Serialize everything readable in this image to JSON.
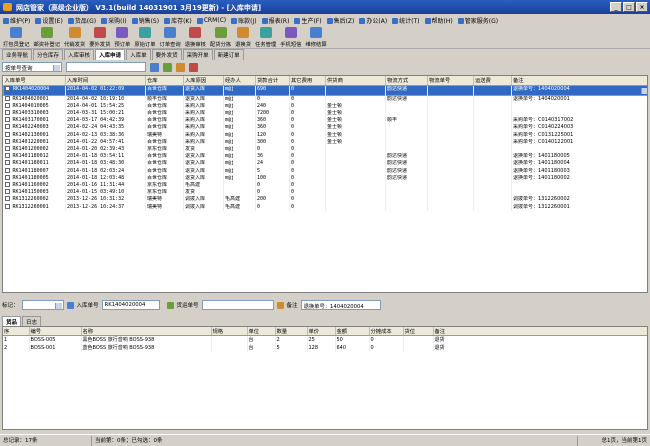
{
  "window": {
    "title": "网店管家（高级企业版） V3.1(build 14031901 3月19更新) - [入库申请]"
  },
  "menu": [
    "维护(P)",
    "设置(E)",
    "货品(G)",
    "采购(I)",
    "销售(S)",
    "库存(K)",
    "CRM(C)",
    "账款(J)",
    "报表(R)",
    "生产(F)",
    "售后(Z)",
    "办公(A)",
    "统计(T)",
    "帮助(H)",
    "管家服务(G)"
  ],
  "toolbar": [
    {
      "label": "打包员登记",
      "color": "#4a7fd0"
    },
    {
      "label": "邮资补登记",
      "color": "#6a9e3a"
    },
    {
      "label": "代销发货",
      "color": "#d08a30"
    },
    {
      "label": "要外发货",
      "color": "#c04a4a"
    },
    {
      "label": "预订单",
      "color": "#7a5ac0"
    },
    {
      "label": "原始订单",
      "color": "#3aa0a0"
    },
    {
      "label": "订单查询",
      "color": "#4a7fd0"
    },
    {
      "label": "退换审核",
      "color": "#c04a4a"
    },
    {
      "label": "配货分拣",
      "color": "#6a9e3a"
    },
    {
      "label": "退换货",
      "color": "#d08a30"
    },
    {
      "label": "任务管理",
      "color": "#3aa0a0"
    },
    {
      "label": "手机短信",
      "color": "#7a5ac0"
    },
    {
      "label": "维修结算",
      "color": "#4a7fd0"
    }
  ],
  "tabs": [
    "业务导航",
    "分仓库存",
    "入库审核",
    "入库申请",
    "入库单",
    "要外发货",
    "采购开单",
    "新建订单"
  ],
  "filter": {
    "select": "按单号查询"
  },
  "grid": {
    "columns": [
      "入库单号",
      "入库时间",
      "仓库",
      "入库原因",
      "经办人",
      "货款合计",
      "其它费用",
      "供货商",
      "物流方式",
      "物流单号",
      "运送费",
      "备注"
    ],
    "rows": [
      [
        "RK1404020004",
        "2014-04-02  01:22:09",
        "百世仓库",
        "退货入库",
        "m@j",
        "690",
        "0",
        "",
        "韵达快递",
        "",
        "",
        "退换单号：1404020004"
      ],
      [
        "RK1404020001",
        "2014-04-02  10:19:10",
        "顺丰仓库",
        "退货入库",
        "m@j",
        "0",
        "0",
        "",
        "韵达快递",
        "",
        "",
        "退换单号：1404020001"
      ],
      [
        "RK1404010005",
        "2014-04-01  15:54:25",
        "百世仓库",
        "采购入库",
        "m@j",
        "240",
        "0",
        "金士顿",
        "",
        "",
        "",
        ""
      ],
      [
        "RK1403310003",
        "2014-03-31  15:00:21",
        "百世仓库",
        "采购入库",
        "m@j",
        "7200",
        "0",
        "金士顿",
        "",
        "",
        "",
        ""
      ],
      [
        "RK1403170001",
        "2014-03-17  04:42:39",
        "百世仓库",
        "采购入库",
        "m@j",
        "360",
        "0",
        "金士顿",
        "顺丰",
        "",
        "",
        "采购单号：C0140317002"
      ],
      [
        "RK1402240003",
        "2014-02-24  04:43:35",
        "百世仓库",
        "采购入库",
        "m@j",
        "360",
        "0",
        "金士顿",
        "",
        "",
        "",
        "采购单号：C0140224003"
      ],
      [
        "RK1402130001",
        "2014-02-13  03:38:36",
        "瑞美特",
        "采购入库",
        "m@j",
        "120",
        "0",
        "金士顿",
        "",
        "",
        "",
        "采购单号：C0131225001"
      ],
      [
        "RK1401220001",
        "2014-01-22  04:57:41",
        "百世仓库",
        "采购入库",
        "m@j",
        "300",
        "0",
        "金士顿",
        "",
        "",
        "",
        "采购单号：C0140122001"
      ],
      [
        "RK1401200002",
        "2014-01-20  02:39:43",
        "京东仓库",
        "发货",
        "m@j",
        "0",
        "0",
        "",
        "",
        "",
        "",
        ""
      ],
      [
        "RK1401180012",
        "2014-01-18  03:54:11",
        "百世仓库",
        "退货入库",
        "m@j",
        "36",
        "0",
        "",
        "韵达快递",
        "",
        "",
        "退换单号：1401180005"
      ],
      [
        "RK1401180011",
        "2014-01-18  03:48:30",
        "百世仓库",
        "退货入库",
        "m@j",
        "24",
        "0",
        "",
        "韵达快递",
        "",
        "",
        "退换单号：1401180004"
      ],
      [
        "RK1401180007",
        "2014-01-18  02:03:24",
        "百世仓库",
        "退货入库",
        "m@j",
        "5",
        "0",
        "",
        "韵达快递",
        "",
        "",
        "退换单号：1401180003"
      ],
      [
        "RK1401180005",
        "2014-01-18  12:03:48",
        "百世仓库",
        "退货入库",
        "m@j",
        "100",
        "0",
        "",
        "韵达快递",
        "",
        "",
        "退换单号：1401180002"
      ],
      [
        "RK1401160002",
        "2014-01-16  11:31:44",
        "京东仓库",
        "毛高建",
        "",
        "0",
        "0",
        "",
        "",
        "",
        "",
        ""
      ],
      [
        "RK1401150003",
        "2014-01-15  03:49:10",
        "京东仓库",
        "发货",
        "",
        "0",
        "0",
        "",
        "",
        "",
        "",
        ""
      ],
      [
        "RK1312260002",
        "2013-12-26  10:31:32",
        "瑞美特",
        "调拨入库",
        "毛高建",
        "200",
        "0",
        "",
        "",
        "",
        "",
        "调拨单号：1312260002"
      ],
      [
        "RK1312260001",
        "2013-12-26  10:24:37",
        "瑞美特",
        "调拨入库",
        "毛高建",
        "0",
        "0",
        "",
        "",
        "",
        "",
        "调拨单号：1312260001"
      ]
    ]
  },
  "detail": {
    "tag_label": "标记：",
    "rk_label": "入库单号",
    "rk_value": "RK1404020004",
    "supplier_label": "货运单号",
    "remark_label": "备注",
    "remark_value": "退换单号：1404020004"
  },
  "tabs2": [
    "货品",
    "日志"
  ],
  "grid2": {
    "columns": [
      "序",
      "编号",
      "名称",
      "规格",
      "单位",
      "数量",
      "单价",
      "金额",
      "分摊成本",
      "货位",
      "备注"
    ],
    "rows": [
      [
        "1",
        "BOSS-005",
        "黑色BOSS 旅行音响 BOSS-938",
        "",
        "台",
        "2",
        "25",
        "50",
        "0",
        "",
        "退货"
      ],
      [
        "2",
        "BOSS-001",
        "蓝色BOSS 旅行音响 BOSS-938",
        "",
        "台",
        "5",
        "128",
        "640",
        "0",
        "",
        "退货"
      ]
    ]
  },
  "status": {
    "total": "总记录：17条",
    "current": "当前第：0条；已勾选：0条",
    "page": "总1页，当前第1页"
  }
}
